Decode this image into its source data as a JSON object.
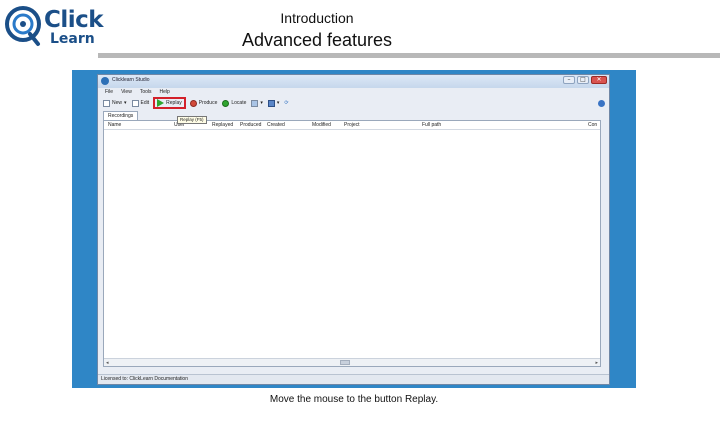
{
  "slide": {
    "logo_top": "Click",
    "logo_bottom": "Learn",
    "title": "Introduction",
    "subtitle": "Advanced features",
    "caption": "Move the mouse to the button Replay."
  },
  "colors": {
    "accent_blue": "#1b4f88",
    "desktop": "#2f86c6",
    "highlight": "#d3202a"
  },
  "window": {
    "title": "Clicklearn Studio",
    "controls": [
      "–",
      "□",
      "✕"
    ],
    "menu": [
      "File",
      "View",
      "Tools",
      "Help"
    ],
    "toolbar": {
      "new": "New",
      "edit": "Edit",
      "replay": "Replay",
      "produce": "Produce",
      "locate": "Locate"
    },
    "tooltip": "Replay (F5)",
    "tab": "Recordings",
    "columns": [
      "Name",
      "User",
      "Replayed",
      "Produced",
      "Created",
      "Modified",
      "Project",
      "Full path",
      "Con"
    ],
    "status": "Licensed to: ClickLearn Documentation"
  }
}
